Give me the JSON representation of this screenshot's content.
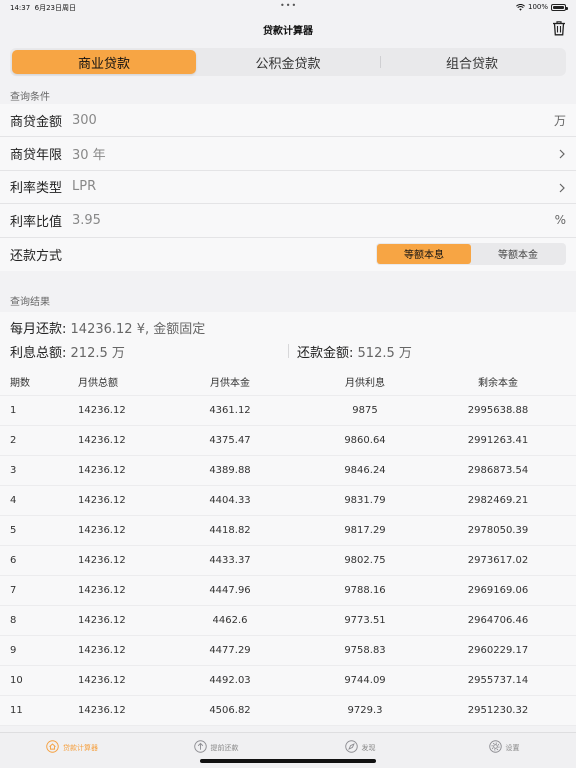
{
  "status": {
    "time": "14:37",
    "date": "6月23日周日",
    "battery": "100%",
    "battery_level": 1.0
  },
  "nav": {
    "title": "贷款计算器",
    "trash_icon": "trash-icon"
  },
  "loan_tabs": [
    {
      "label": "商业贷款",
      "active": true
    },
    {
      "label": "公积金贷款",
      "active": false
    },
    {
      "label": "组合贷款",
      "active": false
    }
  ],
  "query_section": "查询条件",
  "form": {
    "amount": {
      "label": "商贷金额",
      "value": "300",
      "suffix": "万"
    },
    "years": {
      "label": "商贷年限",
      "value": "30 年"
    },
    "rate_type": {
      "label": "利率类型",
      "value": "LPR"
    },
    "rate": {
      "label": "利率比值",
      "value": "3.95",
      "suffix": "%"
    },
    "method": {
      "label": "还款方式",
      "options": [
        "等额本息",
        "等额本金"
      ],
      "selected": "等额本息"
    }
  },
  "result_section": "查询结果",
  "summary": {
    "monthly_label": "每月还款:",
    "monthly_value": "14236.12 ¥, 金额固定",
    "interest_label": "利息总额:",
    "interest_value": "212.5 万",
    "total_label": "还款金额:",
    "total_value": "512.5 万"
  },
  "table": {
    "headers": [
      "期数",
      "月供总额",
      "月供本金",
      "月供利息",
      "剩余本金"
    ],
    "rows": [
      [
        "1",
        "14236.12",
        "4361.12",
        "9875",
        "2995638.88"
      ],
      [
        "2",
        "14236.12",
        "4375.47",
        "9860.64",
        "2991263.41"
      ],
      [
        "3",
        "14236.12",
        "4389.88",
        "9846.24",
        "2986873.54"
      ],
      [
        "4",
        "14236.12",
        "4404.33",
        "9831.79",
        "2982469.21"
      ],
      [
        "5",
        "14236.12",
        "4418.82",
        "9817.29",
        "2978050.39"
      ],
      [
        "6",
        "14236.12",
        "4433.37",
        "9802.75",
        "2973617.02"
      ],
      [
        "7",
        "14236.12",
        "4447.96",
        "9788.16",
        "2969169.06"
      ],
      [
        "8",
        "14236.12",
        "4462.6",
        "9773.51",
        "2964706.46"
      ],
      [
        "9",
        "14236.12",
        "4477.29",
        "9758.83",
        "2960229.17"
      ],
      [
        "10",
        "14236.12",
        "4492.03",
        "9744.09",
        "2955737.14"
      ],
      [
        "11",
        "14236.12",
        "4506.82",
        "9729.3",
        "2951230.32"
      ]
    ]
  },
  "tabbar": [
    {
      "label": "贷款计算器",
      "icon": "home-icon",
      "active": true
    },
    {
      "label": "提前还款",
      "icon": "arrow-up-circle-icon",
      "active": false
    },
    {
      "label": "发现",
      "icon": "compass-icon",
      "active": false
    },
    {
      "label": "设置",
      "icon": "gear-icon",
      "active": false
    }
  ],
  "colors": {
    "accent": "#f7a544",
    "background": "#f2f2f4"
  }
}
